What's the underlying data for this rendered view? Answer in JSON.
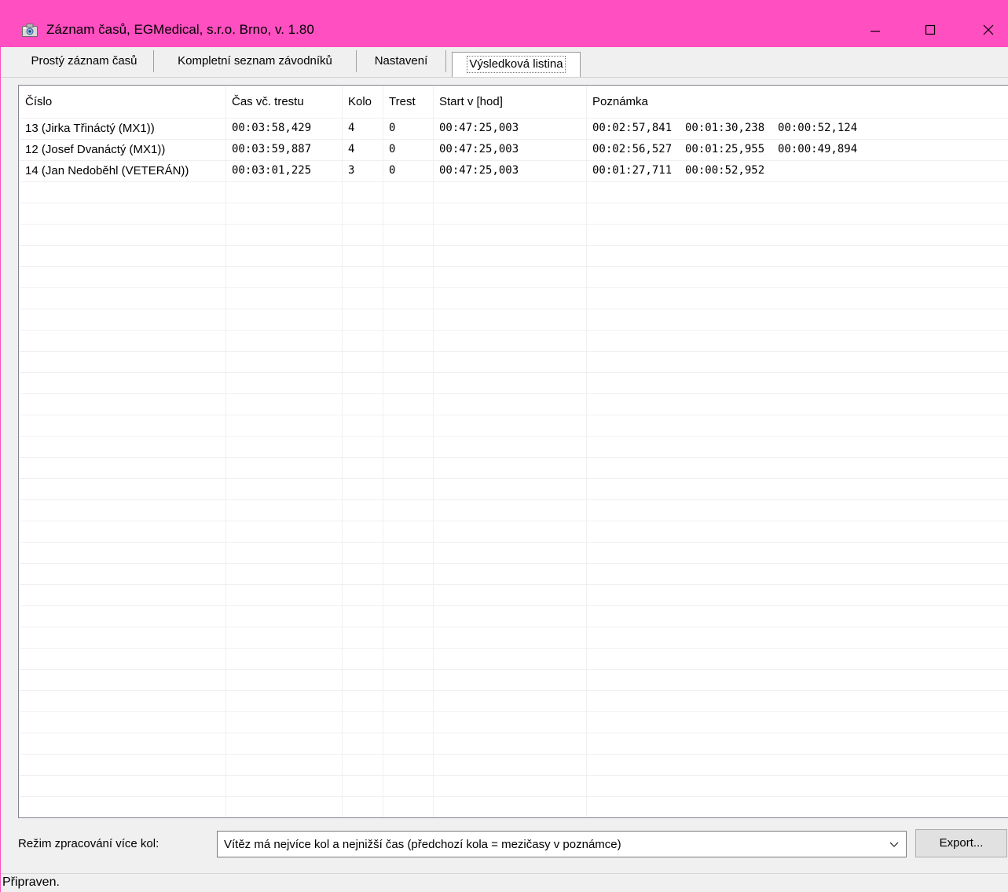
{
  "window": {
    "title": "Záznam časů, EGMedical, s.r.o. Brno,  v. 1.80",
    "icons": {
      "app": "camera-icon",
      "minimize": "minimize-icon",
      "maximize": "maximize-icon",
      "close": "close-icon"
    },
    "accent_color": "#ff4fc1"
  },
  "tabs": [
    {
      "label": "Prostý záznam časů",
      "active": false
    },
    {
      "label": "Kompletní seznam závodníků",
      "active": false
    },
    {
      "label": "Nastavení",
      "active": false
    },
    {
      "label": "Výsledková listina",
      "active": true
    }
  ],
  "results": {
    "columns": [
      "Číslo",
      "Čas vč. trestu",
      "Kolo",
      "Trest",
      "Start v [hod]",
      "Poznámka"
    ],
    "rows": [
      [
        "13 (Jirka Třináctý (MX1))",
        "00:03:58,429",
        "4",
        "0",
        "00:47:25,003",
        "00:02:57,841  00:01:30,238  00:00:52,124"
      ],
      [
        "12 (Josef Dvanáctý (MX1))",
        "00:03:59,887",
        "4",
        "0",
        "00:47:25,003",
        "00:02:56,527  00:01:25,955  00:00:49,894"
      ],
      [
        "14 (Jan Nedoběhl (VETERÁN))",
        "00:03:01,225",
        "3",
        "0",
        "00:47:25,003",
        "00:01:27,711  00:00:52,952"
      ]
    ]
  },
  "mode": {
    "label": "Režim zpracování více kol:",
    "selected": "Vítěz má nejvíce kol a nejnižší čas (předchozí kola = mezičasy v poznámce)",
    "arrow_icon": "chevron-down-icon"
  },
  "export_button": "Export...",
  "status": "Připraven."
}
